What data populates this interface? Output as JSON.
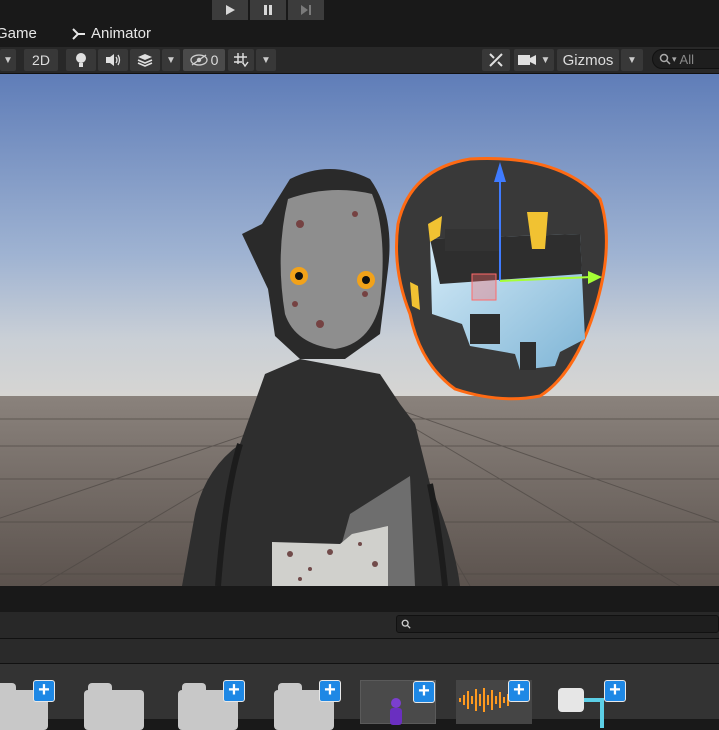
{
  "playbar": {
    "icons": [
      "play-icon",
      "pause-icon",
      "step-icon"
    ]
  },
  "tabs": [
    {
      "label": "Game",
      "icon": "game-icon"
    },
    {
      "label": "Animator",
      "icon": "animator-icon"
    }
  ],
  "toolbar": {
    "mode_2d_label": "2D",
    "hidden_count": "0",
    "gizmos_label": "Gizmos",
    "search_placeholder": "All",
    "icons": [
      "lighting-icon",
      "audio-icon",
      "effects-icon",
      "visibility-icon",
      "grid-icon",
      "tools-icon",
      "camera-icon"
    ]
  },
  "project": {
    "search_icon": "search-icon",
    "assets": [
      {
        "type": "folder"
      },
      {
        "type": "folder"
      },
      {
        "type": "folder"
      },
      {
        "type": "folder"
      },
      {
        "type": "prefab"
      },
      {
        "type": "audio-clip"
      },
      {
        "type": "animator-controller"
      }
    ]
  },
  "colors": {
    "selection_outline": "#ff6a13",
    "gizmo_y": "#3f7bff",
    "gizmo_x": "#a5ff35",
    "add_badge": "#1e88e5",
    "sky": "#7b96c6",
    "ground": "#6c625d"
  }
}
